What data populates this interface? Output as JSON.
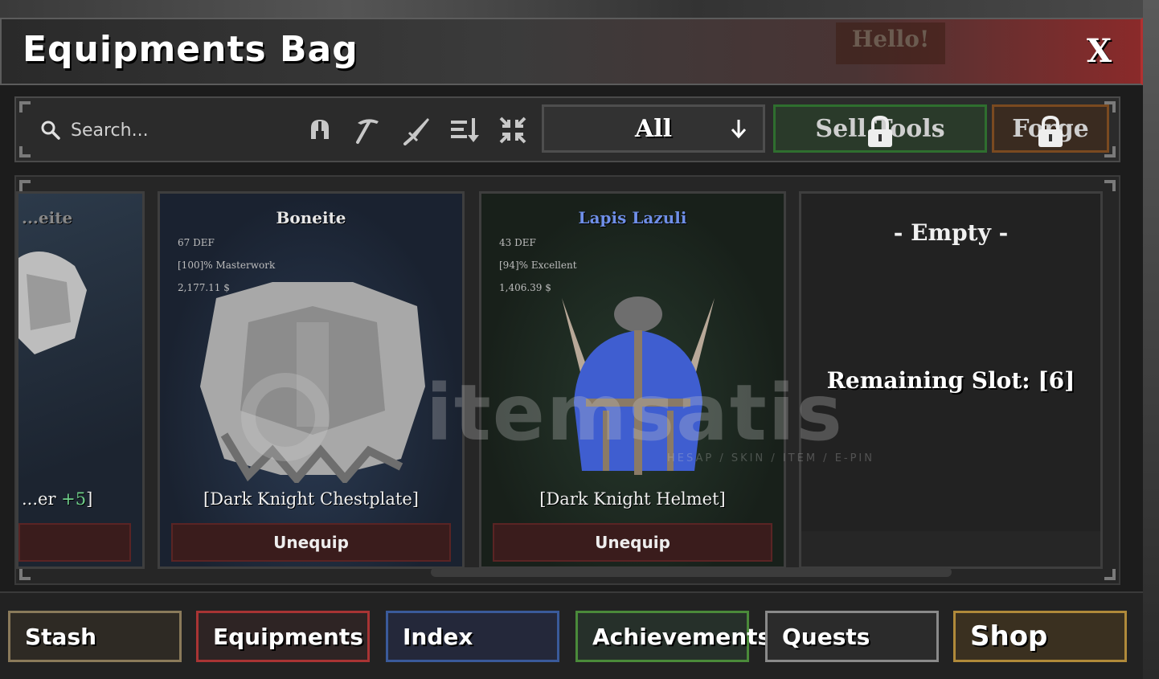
{
  "window": {
    "title": "Equipments Bag",
    "close_label": "X",
    "overlay_text": "Hello!"
  },
  "toolbar": {
    "search_placeholder": "Search...",
    "icons": [
      "helmet-icon",
      "pickaxe-icon",
      "sword-icon",
      "sort-icon",
      "collapse-icon"
    ],
    "filter_value": "All",
    "sell_tools_label": "Sell Tools",
    "forge_label": "Forge"
  },
  "cards": {
    "partial": {
      "name": "...eite",
      "item_prefix": "...er ",
      "item_plus": "+5",
      "item_suffix": "]"
    },
    "boneite": {
      "name": "Boneite",
      "def": "67 DEF",
      "quality": "[100]% Masterwork",
      "price": "2,177.11 $",
      "item": "[Dark Knight Chestplate]",
      "button": "Unequip"
    },
    "lapis": {
      "name": "Lapis Lazuli",
      "def": "43 DEF",
      "quality": "[94]% Excellent",
      "price": "1,406.39 $",
      "item": "[Dark Knight Helmet]",
      "button": "Unequip"
    },
    "empty": {
      "title": "- Empty -",
      "remaining": "Remaining Slot: [6]"
    }
  },
  "watermark": {
    "text": "itemsatis",
    "tagline": "HESAP / SKIN / ITEM / E-PIN"
  },
  "bottom_nav": [
    {
      "label": "Stash",
      "color": "#8a7a5a"
    },
    {
      "label": "Equipments",
      "color": "#a83434"
    },
    {
      "label": "Index",
      "color": "#3a5a9a"
    },
    {
      "label": "Achievements",
      "color": "#4a8a3a"
    },
    {
      "label": "Quests",
      "color": "#8a8a8a"
    },
    {
      "label": "Shop",
      "color": "#b08a3a"
    }
  ],
  "colors": {
    "lapis_name": "#6f8fe8",
    "unequip_bg": "#3a1c1c",
    "close_bar": "#b23030"
  }
}
